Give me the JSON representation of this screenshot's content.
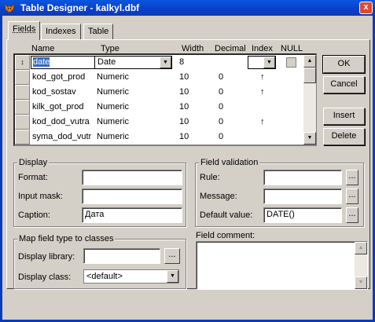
{
  "window": {
    "title": "Table Designer - kalkyl.dbf",
    "close_glyph": "x"
  },
  "tabs": [
    {
      "label": "Fields",
      "active": true
    },
    {
      "label": "Indexes",
      "active": false
    },
    {
      "label": "Table",
      "active": false
    }
  ],
  "columns": {
    "name": "Name",
    "type": "Type",
    "width": "Width",
    "decimal": "Decimal",
    "index": "Index",
    "null": "NULL"
  },
  "rows": [
    {
      "marker": "↕",
      "name": "date",
      "type": "Date",
      "width": "8",
      "decimal": "",
      "index": "",
      "editing": true
    },
    {
      "marker": "",
      "name": "kod_got_prod",
      "type": "Numeric",
      "width": "10",
      "decimal": "0",
      "index": "↑"
    },
    {
      "marker": "",
      "name": "kod_sostav",
      "type": "Numeric",
      "width": "10",
      "decimal": "0",
      "index": "↑"
    },
    {
      "marker": "",
      "name": "kilk_got_prod",
      "type": "Numeric",
      "width": "10",
      "decimal": "0",
      "index": ""
    },
    {
      "marker": "",
      "name": "kod_dod_vutra",
      "type": "Numeric",
      "width": "10",
      "decimal": "0",
      "index": "↑"
    },
    {
      "marker": "",
      "name": "syma_dod_vutr",
      "type": "Numeric",
      "width": "10",
      "decimal": "0",
      "index": ""
    }
  ],
  "buttons": {
    "ok": "OK",
    "cancel": "Cancel",
    "insert": "Insert",
    "delete": "Delete"
  },
  "display": {
    "title": "Display",
    "format_label": "Format:",
    "format_value": "",
    "input_mask_label": "Input mask:",
    "input_mask_value": "",
    "caption_label": "Caption:",
    "caption_value": "Дата"
  },
  "validation": {
    "title": "Field validation",
    "rule_label": "Rule:",
    "rule_value": "",
    "message_label": "Message:",
    "message_value": "",
    "default_label": "Default value:",
    "default_value": "DATE()",
    "ellipsis": "..."
  },
  "map": {
    "title": "Map field type to classes",
    "library_label": "Display library:",
    "library_value": "",
    "class_label": "Display class:",
    "class_value": "<default>"
  },
  "comment": {
    "label": "Field comment:",
    "value": ""
  },
  "colors": {
    "titlebar": "#0a56e0",
    "face": "#d4d0c8",
    "selection": "#316ac5"
  },
  "icons": {
    "app": "fox-icon"
  }
}
